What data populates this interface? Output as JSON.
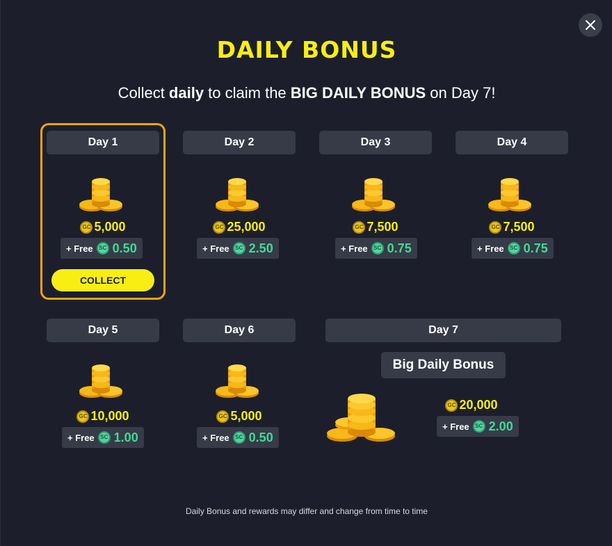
{
  "modal": {
    "title": "DAILY BONUS",
    "subtitle": {
      "part1": "Collect ",
      "bold1": "daily",
      "part2": " to claim the ",
      "bold2": "BIG DAILY BONUS",
      "part3": " on Day 7!"
    },
    "close_icon": "close-icon",
    "footer": "Daily Bonus and rewards may differ and change from time to time"
  },
  "days": [
    {
      "label": "Day 1",
      "gc": "5,000",
      "free_prefix": "+ Free",
      "sc": "0.50",
      "collect_label": "COLLECT"
    },
    {
      "label": "Day 2",
      "gc": "25,000",
      "free_prefix": "+ Free",
      "sc": "2.50"
    },
    {
      "label": "Day 3",
      "gc": "7,500",
      "free_prefix": "+ Free",
      "sc": "0.75"
    },
    {
      "label": "Day 4",
      "gc": "7,500",
      "free_prefix": "+ Free",
      "sc": "0.75"
    },
    {
      "label": "Day 5",
      "gc": "10,000",
      "free_prefix": "+ Free",
      "sc": "1.00"
    },
    {
      "label": "Day 6",
      "gc": "5,000",
      "free_prefix": "+ Free",
      "sc": "0.50"
    },
    {
      "label": "Day 7",
      "big_label": "Big Daily Bonus",
      "gc": "20,000",
      "free_prefix": "+ Free",
      "sc": "2.00"
    }
  ],
  "coin_badges": {
    "gc": "GC",
    "sc": "SC"
  },
  "colors": {
    "accent_yellow": "#f8ee14",
    "sc_green": "#3ddc97",
    "active_border": "#f5a30c",
    "background": "#1c1f2b",
    "chip": "#373a47"
  }
}
